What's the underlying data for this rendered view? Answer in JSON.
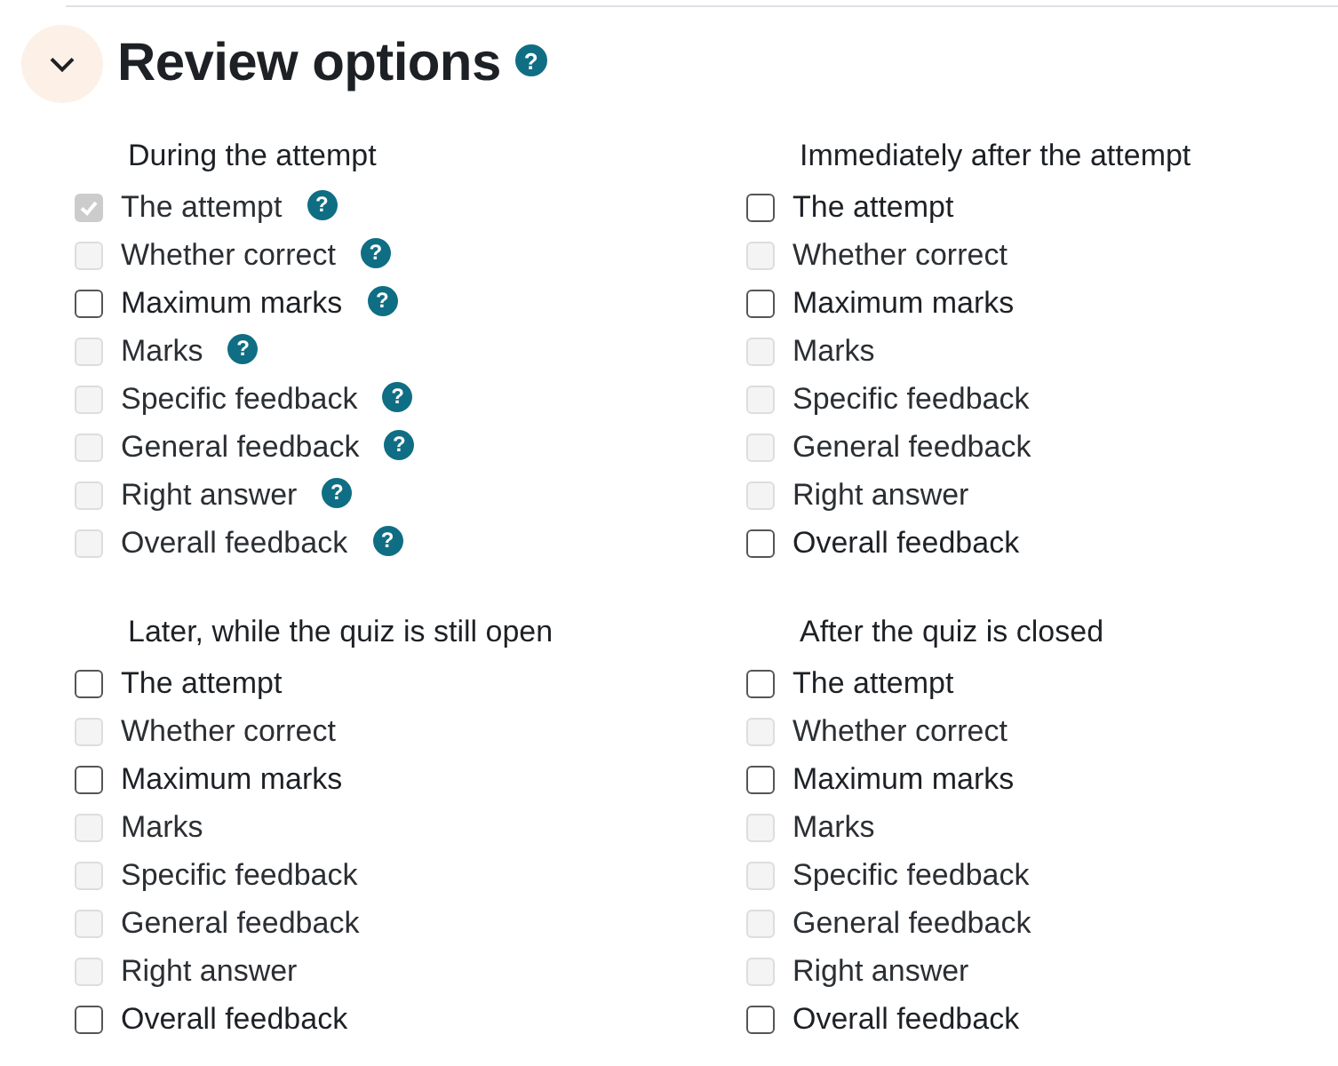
{
  "section": {
    "title": "Review options",
    "expanded": true,
    "help_icon": "?"
  },
  "groups": [
    {
      "heading": "During the attempt",
      "options": [
        {
          "label": "The attempt",
          "checked": true,
          "disabled": true,
          "help_icon": "?"
        },
        {
          "label": "Whether correct",
          "checked": false,
          "disabled": true,
          "help_icon": "?"
        },
        {
          "label": "Maximum marks",
          "checked": false,
          "disabled": false,
          "help_icon": "?"
        },
        {
          "label": "Marks",
          "checked": false,
          "disabled": true,
          "help_icon": "?"
        },
        {
          "label": "Specific feedback",
          "checked": false,
          "disabled": true,
          "help_icon": "?"
        },
        {
          "label": "General feedback",
          "checked": false,
          "disabled": true,
          "help_icon": "?"
        },
        {
          "label": "Right answer",
          "checked": false,
          "disabled": true,
          "help_icon": "?"
        },
        {
          "label": "Overall feedback",
          "checked": false,
          "disabled": true,
          "help_icon": "?"
        }
      ]
    },
    {
      "heading": "Immediately after the attempt",
      "options": [
        {
          "label": "The attempt",
          "checked": false,
          "disabled": false
        },
        {
          "label": "Whether correct",
          "checked": false,
          "disabled": true
        },
        {
          "label": "Maximum marks",
          "checked": false,
          "disabled": false
        },
        {
          "label": "Marks",
          "checked": false,
          "disabled": true
        },
        {
          "label": "Specific feedback",
          "checked": false,
          "disabled": true
        },
        {
          "label": "General feedback",
          "checked": false,
          "disabled": true
        },
        {
          "label": "Right answer",
          "checked": false,
          "disabled": true
        },
        {
          "label": "Overall feedback",
          "checked": false,
          "disabled": false
        }
      ]
    },
    {
      "heading": "Later, while the quiz is still open",
      "options": [
        {
          "label": "The attempt",
          "checked": false,
          "disabled": false
        },
        {
          "label": "Whether correct",
          "checked": false,
          "disabled": true
        },
        {
          "label": "Maximum marks",
          "checked": false,
          "disabled": false
        },
        {
          "label": "Marks",
          "checked": false,
          "disabled": true
        },
        {
          "label": "Specific feedback",
          "checked": false,
          "disabled": true
        },
        {
          "label": "General feedback",
          "checked": false,
          "disabled": true
        },
        {
          "label": "Right answer",
          "checked": false,
          "disabled": true
        },
        {
          "label": "Overall feedback",
          "checked": false,
          "disabled": false
        }
      ]
    },
    {
      "heading": "After the quiz is closed",
      "options": [
        {
          "label": "The attempt",
          "checked": false,
          "disabled": false
        },
        {
          "label": "Whether correct",
          "checked": false,
          "disabled": true
        },
        {
          "label": "Maximum marks",
          "checked": false,
          "disabled": false
        },
        {
          "label": "Marks",
          "checked": false,
          "disabled": true
        },
        {
          "label": "Specific feedback",
          "checked": false,
          "disabled": true
        },
        {
          "label": "General feedback",
          "checked": false,
          "disabled": true
        },
        {
          "label": "Right answer",
          "checked": false,
          "disabled": true
        },
        {
          "label": "Overall feedback",
          "checked": false,
          "disabled": false
        }
      ]
    }
  ]
}
